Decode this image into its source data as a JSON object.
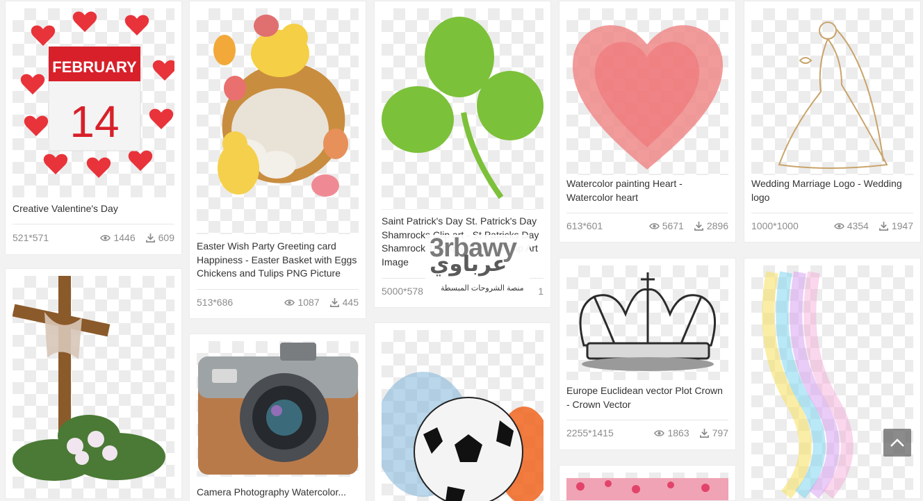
{
  "cards": [
    {
      "title": "Creative Valentine's Day",
      "dims": "521*571",
      "views": "1446",
      "downloads": "609",
      "image": "valentine-calendar-february-14"
    },
    {
      "title": "Easter Wish Party Greeting card Happiness - Easter Basket with Eggs Chickens and Tulips PNG Picture",
      "dims": "513*686",
      "views": "1087",
      "downloads": "445",
      "image": "easter-basket-chicks"
    },
    {
      "title": "Saint Patrick's Day St. Patrick's Day Shamrocks Clip art - St Patricks Day Shamrock Transparent PNG Clip Art Image",
      "dims": "5000*578",
      "views": "",
      "downloads": "1",
      "image": "shamrock"
    },
    {
      "title": "Watercolor painting Heart - Watercolor heart",
      "dims": "613*601",
      "views": "5671",
      "downloads": "2896",
      "image": "watercolor-heart"
    },
    {
      "title": "Wedding Marriage Logo - Wedding logo",
      "dims": "1000*1000",
      "views": "4354",
      "downloads": "1947",
      "image": "bride-line-art"
    },
    {
      "title": "",
      "dims": "",
      "views": "",
      "downloads": "",
      "image": "easter-cross-lilies"
    },
    {
      "title": "Camera Photography Watercolor...",
      "dims": "",
      "views": "",
      "downloads": "",
      "image": "vintage-camera"
    },
    {
      "title": "",
      "dims": "",
      "views": "",
      "downloads": "",
      "image": "soccer-ball-fire-water"
    },
    {
      "title": "Europe Euclidean vector Plot Crown - Crown Vector",
      "dims": "2255*1415",
      "views": "1863",
      "downloads": "797",
      "image": "crown"
    },
    {
      "title": "",
      "dims": "",
      "views": "",
      "downloads": "",
      "image": "pink-hearts"
    },
    {
      "title": "",
      "dims": "",
      "views": "",
      "downloads": "",
      "image": "rainbow-light-swirl"
    }
  ],
  "watermark": {
    "latin": "3rbawy",
    "arabic": "عرباوي",
    "subtitle": "منصة الشروحات المبسطة"
  },
  "icons": {
    "views": "eye-icon",
    "downloads": "download-icon",
    "scroll_top": "chevron-up-icon"
  }
}
